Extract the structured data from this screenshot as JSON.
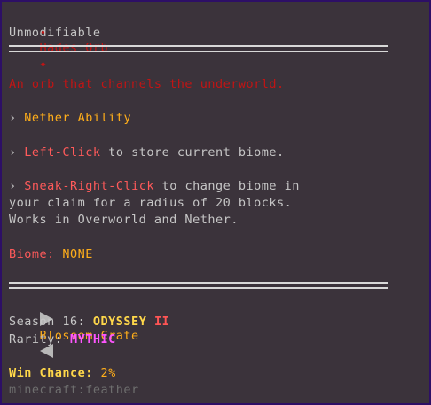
{
  "item": {
    "name": "Hades Orb",
    "deco_icon": "✦",
    "modifiable": "Unmodifiable",
    "description": "An orb that channels the underworld.",
    "ability_prefix": "›",
    "ability": "Nether Ability",
    "left_click_key": "Left-Click",
    "left_click_text": " to store current biome.",
    "sneak_key": "Sneak-Right-Click",
    "sneak_text_1": " to change biome in",
    "sneak_text_2": "your claim for a radius of 20 blocks.",
    "sneak_text_3": "Works in Overworld and Nether.",
    "biome_label": "Biome:",
    "biome_value": "NONE"
  },
  "crate": {
    "name": "Blossom Crate",
    "season_label": "Season 16:",
    "season_name": "ODYSSEY",
    "season_numeral": "II",
    "rarity_label": "Rarity:",
    "rarity_value": "MYTHIC",
    "win_chance_label": "Win Chance:",
    "win_chance_value": "2%",
    "item_id": "minecraft:feather"
  },
  "colors": {
    "background": "#3b333b",
    "border": "#2d0f66",
    "title_red": "#c21414",
    "accent_orange": "#ffae1a",
    "accent_pink": "#ff5a5a",
    "mythic_magenta": "#ff55ff"
  }
}
